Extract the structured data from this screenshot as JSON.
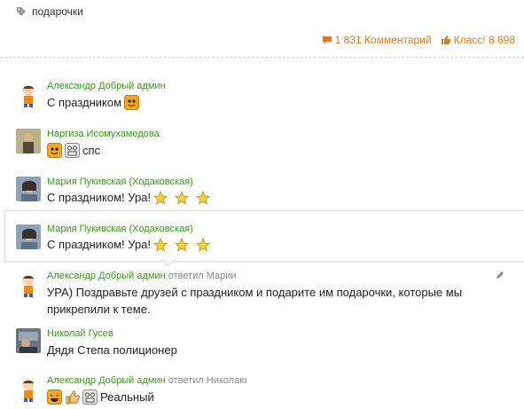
{
  "tag": {
    "label": "подарочки"
  },
  "stats": {
    "comments_label": "1 831 Комментарий",
    "likes_label": "Класс! 8 698"
  },
  "colors": {
    "author": "#3a9a1a",
    "accent": "#e07b1a",
    "muted": "#888888"
  },
  "comments": [
    {
      "author": "Александр Добрый",
      "role": "админ",
      "reply_to": "",
      "text": "С праздником",
      "emojis": [
        "orange-smiley-icon"
      ]
    },
    {
      "author": "Наргиза Исомухамедова",
      "role": "",
      "reply_to": "",
      "text": "спс",
      "emojis": [
        "orange-smiley-icon",
        "grinning-smiley-icon"
      ]
    },
    {
      "author": "Мария Пукивская (Ходаковская)",
      "role": "",
      "reply_to": "",
      "text": "С праздником! Ура!",
      "emojis": [
        "star-icon",
        "star-icon",
        "star-icon"
      ]
    },
    {
      "author": "Мария Пукивская (Ходаковская)",
      "role": "",
      "reply_to": "",
      "text": "С праздником! Ура!",
      "emojis": [
        "star-icon",
        "star-icon",
        "star-icon"
      ],
      "highlighted": true
    },
    {
      "author": "Александр Добрый",
      "role": "админ",
      "reply_to": "ответил Марии",
      "text": "УРА) Поздравьте друзей с праздником и подарите им подарочки, которые мы прикрепили к теме."
    },
    {
      "author": "Николай Гусев",
      "role": "",
      "reply_to": "",
      "text": "Дядя Степа полиционер"
    },
    {
      "author": "Александр Добрый",
      "role": "админ",
      "reply_to": "ответил Николаю",
      "text": "Реальный",
      "emojis": [
        "laughing-smiley-icon",
        "thumbs-up-icon",
        "grinning-smiley-icon"
      ]
    }
  ]
}
